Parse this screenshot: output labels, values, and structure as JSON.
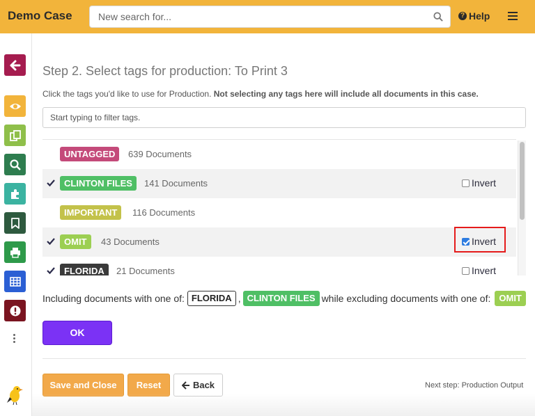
{
  "header": {
    "brand": "Demo Case",
    "search_placeholder": "New search for...",
    "help_label": "Help",
    "icons": [
      "search-icon",
      "help-icon",
      "hamburger-menu-icon"
    ]
  },
  "sidebar": {
    "items": [
      {
        "name": "back",
        "icon": "arrow-left-icon",
        "color": "#a51c4f"
      },
      {
        "name": "view",
        "icon": "eye-icon",
        "color": "#f2b43b"
      },
      {
        "name": "copy",
        "icon": "copy-icon",
        "color": "#8fbf4a"
      },
      {
        "name": "search",
        "icon": "search-icon",
        "color": "#2e7d4f"
      },
      {
        "name": "plugins",
        "icon": "puzzle-icon",
        "color": "#3bb3a1"
      },
      {
        "name": "bookmarks",
        "icon": "bookmark-icon",
        "color": "#2e5a3f"
      },
      {
        "name": "print",
        "icon": "printer-icon",
        "color": "#2e9a4a"
      },
      {
        "name": "table",
        "icon": "table-icon",
        "color": "#2b5fd4"
      },
      {
        "name": "alert",
        "icon": "exclamation-icon",
        "color": "#7a1420"
      }
    ]
  },
  "main": {
    "title": "Step 2. Select tags for production: To Print 3",
    "instruction": "Click the tags you'd like to use for Production.",
    "instruction_bold": "Not selecting any tags here will include all documents in this case.",
    "filter_placeholder": "Start typing to filter tags.",
    "tags": [
      {
        "label": "UNTAGGED",
        "count": "639 Documents",
        "color": "#c44a7a",
        "selected": false,
        "invert_shown": false,
        "invert_checked": false
      },
      {
        "label": "CLINTON FILES",
        "count": "141 Documents",
        "color": "#4fbf65",
        "selected": true,
        "invert_shown": true,
        "invert_checked": false
      },
      {
        "label": "IMPORTANT",
        "count": "116 Documents",
        "color": "#c3c24a",
        "selected": false,
        "invert_shown": false,
        "invert_checked": false
      },
      {
        "label": "OMIT",
        "count": "43 Documents",
        "color": "#9ccf52",
        "selected": true,
        "invert_shown": true,
        "invert_checked": true
      },
      {
        "label": "FLORIDA",
        "count": "21 Documents",
        "color": "#3a3a3a",
        "selected": true,
        "invert_shown": true,
        "invert_checked": false
      }
    ],
    "invert_label": "Invert",
    "summary": {
      "prefix": "Including documents with one of:",
      "included": [
        "FLORIDA",
        "CLINTON FILES"
      ],
      "separator": ",",
      "middle": "while excluding documents with one of:",
      "excluded": [
        "OMIT"
      ]
    },
    "ok_label": "OK",
    "buttons": {
      "save_close": "Save and Close",
      "reset": "Reset",
      "back": "Back"
    },
    "next_step": "Next step: Production Output"
  }
}
